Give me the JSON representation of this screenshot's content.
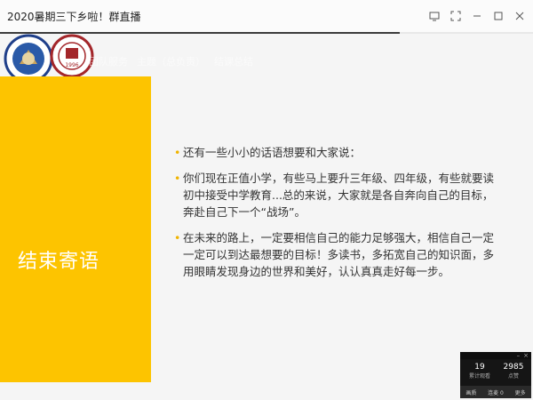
{
  "window": {
    "title": "2020暑期三下乡啦！群直播",
    "controls": [
      "screen-icon",
      "expand-icon",
      "minimize-icon",
      "maximize-icon",
      "close-icon"
    ]
  },
  "slide": {
    "header_items": [
      "团队服务",
      "主题（总负责）",
      "结课总结"
    ],
    "logo_left_text": "2003",
    "logo_right_text": "1996",
    "side_title": "结束寄语",
    "bullets": [
      "还有一些小小的话语想要和大家说：",
      "你们现在正值小学，有些马上要升三年级、四年级，有些就要读初中接受中学教育...总的来说，大家就是各自奔向自己的目标，奔赴自己下一个“战场”。",
      "在未来的路上，一定要相信自己的能力足够强大，相信自己一定一定可以到达最想要的目标！多读书，多拓宽自己的知识面，多用眼睛发现身边的世界和美好，认认真真走好每一步。"
    ],
    "accent_color": "#FDC400"
  },
  "live_panel": {
    "viewers": "19",
    "viewers_label": "累计观看",
    "likes": "2985",
    "likes_label": "点赞",
    "buttons": [
      "画质",
      "连麦  0",
      "更多"
    ]
  }
}
